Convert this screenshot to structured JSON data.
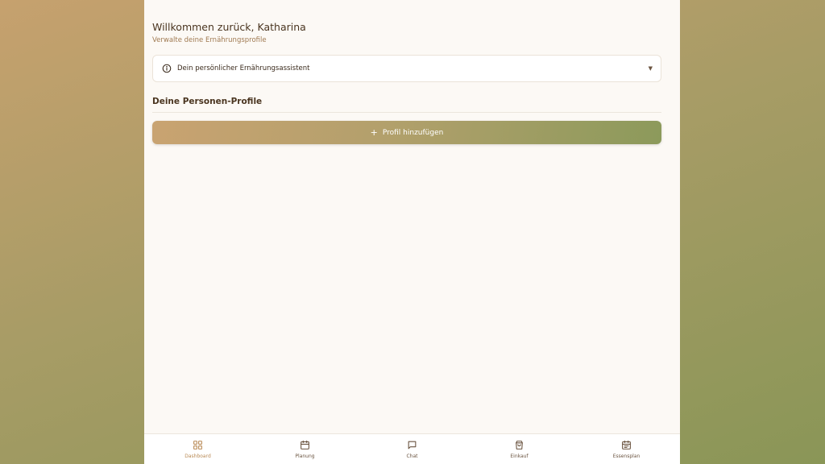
{
  "header": {
    "greeting": "Willkommen zurück, Katharina",
    "subtitle": "Verwalte deine Ernährungsprofile"
  },
  "assistant": {
    "icon": "info-icon",
    "label": "Dein persönlicher Ernährungsassistent",
    "expanded": false
  },
  "profiles": {
    "title": "Deine Personen-Profile",
    "add_button": "Profil hinzufügen"
  },
  "nav": {
    "items": [
      {
        "label": "Dashboard",
        "icon": "grid-icon",
        "active": true
      },
      {
        "label": "Planung",
        "icon": "calendar-icon",
        "active": false
      },
      {
        "label": "Chat",
        "icon": "chat-icon",
        "active": false
      },
      {
        "label": "Einkauf",
        "icon": "shopping-bag-icon",
        "active": false
      },
      {
        "label": "Essensplan",
        "icon": "meal-plan-icon",
        "active": false
      }
    ]
  },
  "colors": {
    "accent": "#b98a55",
    "gradient_start": "#c9a371",
    "gradient_end": "#8c9a5b",
    "text_dark": "#4a3520"
  }
}
